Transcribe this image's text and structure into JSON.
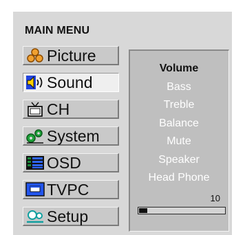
{
  "menu": {
    "title": "MAIN MENU",
    "items": [
      {
        "label": "Picture",
        "icon": "picture-icon"
      },
      {
        "label": "Sound",
        "icon": "speaker-icon",
        "selected": true
      },
      {
        "label": "CH",
        "icon": "tv-antenna-icon"
      },
      {
        "label": "System",
        "icon": "gears-icon"
      },
      {
        "label": "OSD",
        "icon": "osd-icon"
      },
      {
        "label": "TVPC",
        "icon": "monitor-icon"
      },
      {
        "label": "Setup",
        "icon": "setup-icon"
      }
    ]
  },
  "submenu": {
    "items": [
      {
        "label": "Volume",
        "active": true
      },
      {
        "label": "Bass"
      },
      {
        "label": "Treble"
      },
      {
        "label": "Balance"
      },
      {
        "label": "Mute"
      },
      {
        "label": "Speaker"
      },
      {
        "label": "Head Phone"
      }
    ],
    "value": "10",
    "level_percent": 10
  },
  "colors": {
    "panel": "#d8d8d8",
    "submenu_bg": "#bfbfbf",
    "submenu_text": "#ffffff",
    "active_text": "#111111"
  }
}
